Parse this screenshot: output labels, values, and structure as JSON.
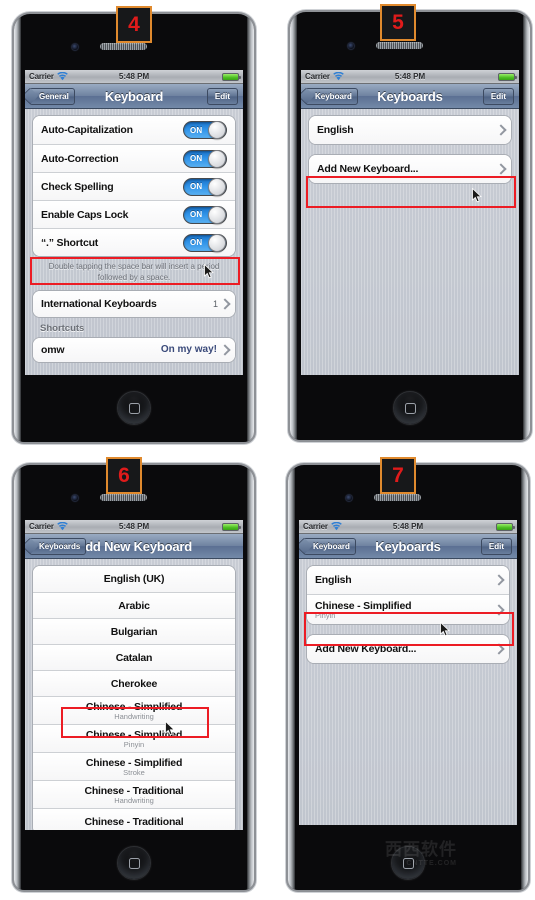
{
  "status_bar": {
    "carrier": "Carrier",
    "time": "5:48 PM",
    "wifi_icon": "wifi-icon",
    "battery_icon": "battery-full-icon"
  },
  "watermark": {
    "text": "西西软件",
    "sub": "CNTTE.COM"
  },
  "panels": [
    {
      "step": "4",
      "nav": {
        "back": "General",
        "title": "Keyboard",
        "edit": "Edit"
      },
      "toggles": [
        {
          "label": "Auto-Capitalization",
          "state": "ON"
        },
        {
          "label": "Auto-Correction",
          "state": "ON"
        },
        {
          "label": "Check Spelling",
          "state": "ON"
        },
        {
          "label": "Enable Caps Lock",
          "state": "ON"
        },
        {
          "label": "“.” Shortcut",
          "state": "ON"
        }
      ],
      "footnote": "Double tapping the space bar will insert a period followed by a space.",
      "intl_row": {
        "label": "International Keyboards",
        "count": "1"
      },
      "shortcuts_header": "Shortcuts",
      "shortcut_row": {
        "label": "omw",
        "value": "On my way!"
      }
    },
    {
      "step": "5",
      "nav": {
        "back": "Keyboard",
        "title": "Keyboards",
        "edit": "Edit"
      },
      "rows": [
        {
          "label": "English"
        },
        {
          "label": "Add New Keyboard..."
        }
      ]
    },
    {
      "step": "6",
      "nav": {
        "back": "Keyboards",
        "title": "Add New Keyboard",
        "edit": ""
      },
      "languages": [
        {
          "label": "English (UK)",
          "sub": ""
        },
        {
          "label": "Arabic",
          "sub": ""
        },
        {
          "label": "Bulgarian",
          "sub": ""
        },
        {
          "label": "Catalan",
          "sub": ""
        },
        {
          "label": "Cherokee",
          "sub": ""
        },
        {
          "label": "Chinese - Simplified",
          "sub": "Handwriting"
        },
        {
          "label": "Chinese - Simplified",
          "sub": "Pinyin"
        },
        {
          "label": "Chinese - Simplified",
          "sub": "Stroke"
        },
        {
          "label": "Chinese - Traditional",
          "sub": "Handwriting"
        },
        {
          "label": "Chinese - Traditional",
          "sub": ""
        }
      ]
    },
    {
      "step": "7",
      "nav": {
        "back": "Keyboard",
        "title": "Keyboards",
        "edit": "Edit"
      },
      "rows": [
        {
          "label": "English",
          "sub": ""
        },
        {
          "label": "Chinese - Simplified",
          "sub": "Pinyin"
        }
      ],
      "add_row": {
        "label": "Add New Keyboard..."
      }
    }
  ]
}
